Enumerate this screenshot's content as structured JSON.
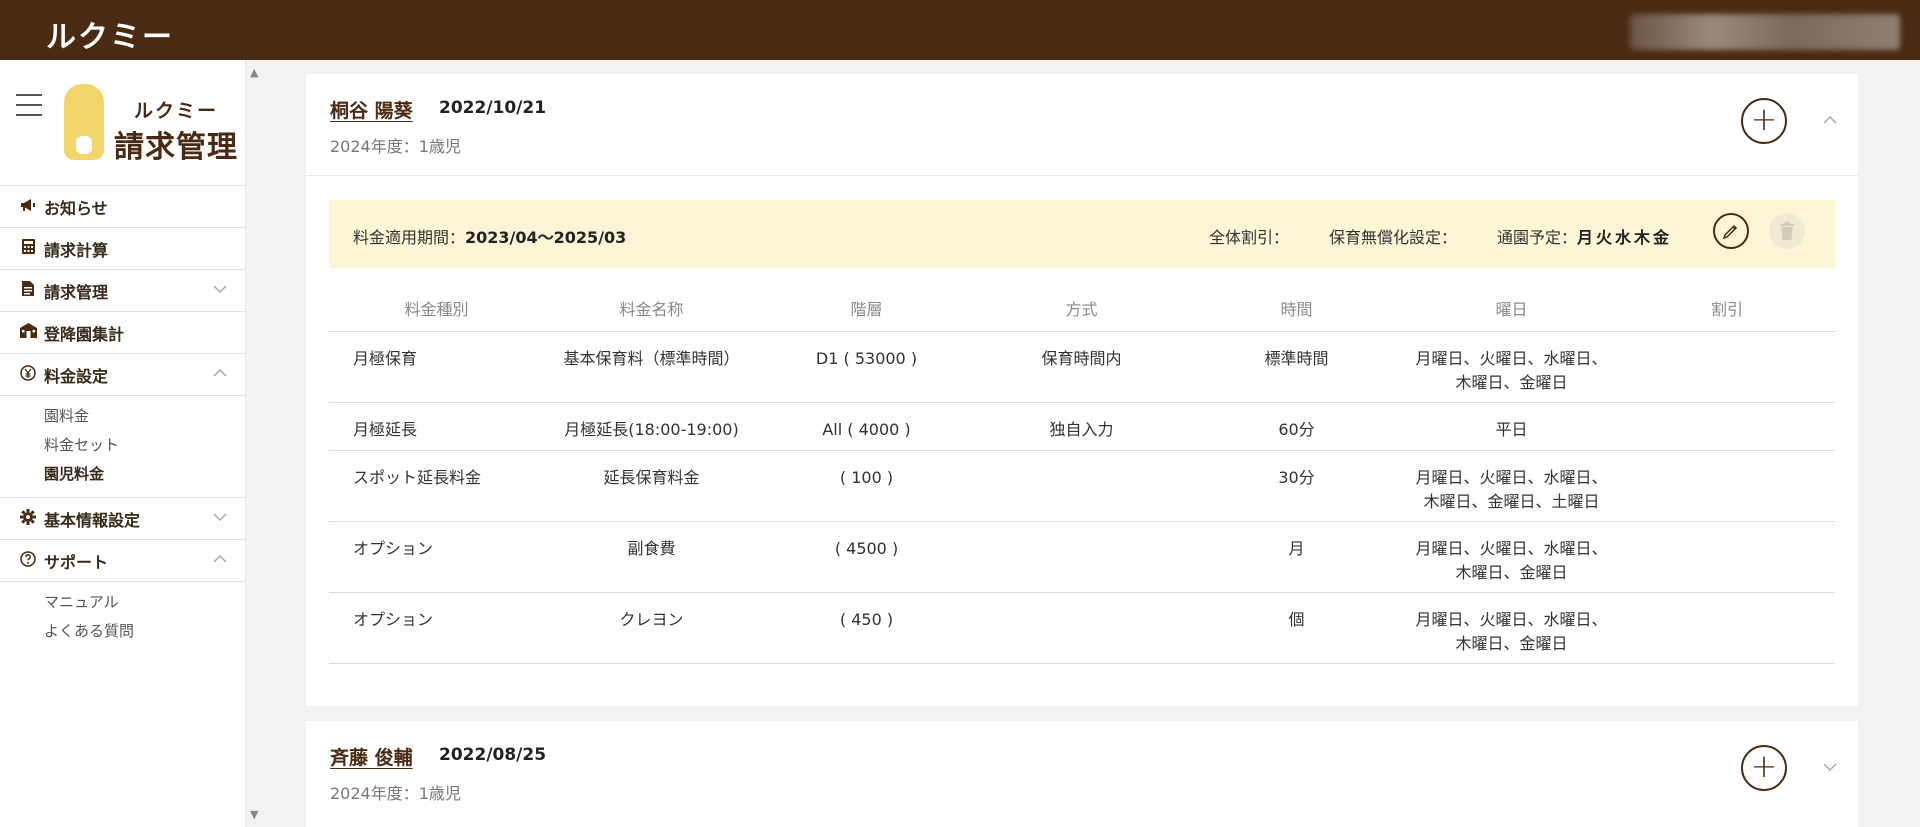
{
  "app": {
    "brand": "ルクミー"
  },
  "sidebar": {
    "logo_small": "ルクミー",
    "logo_big": "請求管理",
    "items": [
      {
        "label": "お知らせ",
        "icon": "megaphone-icon"
      },
      {
        "label": "請求計算",
        "icon": "calculator-icon"
      },
      {
        "label": "請求管理",
        "icon": "document-icon",
        "expanded": false
      },
      {
        "label": "登降園集計",
        "icon": "school-icon"
      },
      {
        "label": "料金設定",
        "icon": "yen-icon",
        "expanded": true,
        "children": [
          "園料金",
          "料金セット",
          "園児料金"
        ],
        "active_child": "園児料金"
      },
      {
        "label": "基本情報設定",
        "icon": "gear-icon",
        "expanded": false
      },
      {
        "label": "サポート",
        "icon": "help-icon",
        "expanded": true,
        "children": [
          "マニュアル",
          "よくある質問"
        ]
      }
    ]
  },
  "children": [
    {
      "name": "桐谷 陽葵",
      "birthdate": "2022/10/21",
      "age": "2024年度：1歳児",
      "expanded": true,
      "fee_period_label": "料金適用期間：",
      "fee_period_value": "2023/04〜2025/03",
      "discount_label": "全体割引：",
      "free_label": "保育無償化設定：",
      "days_label": "通園予定：",
      "days_value": "月火水木金",
      "table": {
        "headers": [
          "料金種別",
          "料金名称",
          "階層",
          "方式",
          "時間",
          "曜日",
          "割引"
        ],
        "rows": [
          {
            "type": "月極保育",
            "name": "基本保育料（標準時間）",
            "tier": "D1 ( 53000 )",
            "method": "保育時間内",
            "time": "標準時間",
            "days1": "月曜日、火曜日、水曜日、",
            "days2": "木曜日、金曜日",
            "discount": ""
          },
          {
            "type": "月極延長",
            "name": "月極延長(18:00-19:00)",
            "tier": "All ( 4000 )",
            "method": "独自入力",
            "time": "60分",
            "days1": "平日",
            "days2": "",
            "discount": ""
          },
          {
            "type": "スポット延長料金",
            "name": "延長保育料金",
            "tier": "( 100 )",
            "method": "",
            "time": "30分",
            "days1": "月曜日、火曜日、水曜日、",
            "days2": "木曜日、金曜日、土曜日",
            "discount": ""
          },
          {
            "type": "オプション",
            "name": "副食費",
            "tier": "( 4500 )",
            "method": "",
            "time": "月",
            "days1": "月曜日、火曜日、水曜日、",
            "days2": "木曜日、金曜日",
            "discount": ""
          },
          {
            "type": "オプション",
            "name": "クレヨン",
            "tier": "( 450 )",
            "method": "",
            "time": "個",
            "days1": "月曜日、火曜日、水曜日、",
            "days2": "木曜日、金曜日",
            "discount": ""
          }
        ]
      }
    },
    {
      "name": "斉藤 俊輔",
      "birthdate": "2022/08/25",
      "age": "2024年度：1歳児",
      "expanded": false
    }
  ],
  "colors": {
    "header_bg": "#4a2a12",
    "accent": "#4a2a12",
    "fee_bar_bg": "#fdf6d6",
    "logo_yellow": "#f2d66a"
  }
}
